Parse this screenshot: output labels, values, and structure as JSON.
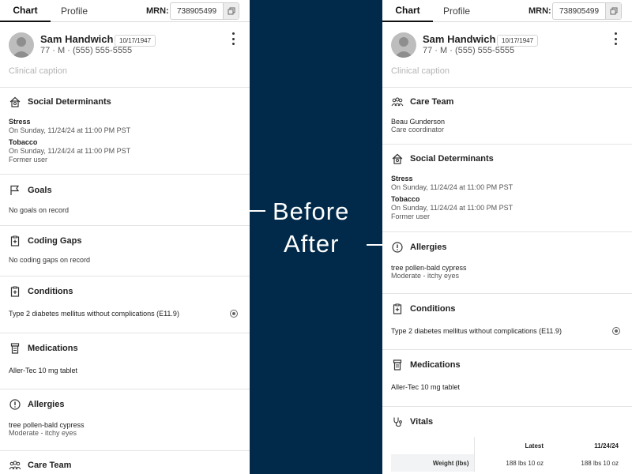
{
  "before": {
    "tabs": {
      "chart": "Chart",
      "profile": "Profile"
    },
    "mrn_label": "MRN:",
    "mrn_value": "738905499",
    "patient": {
      "name": "Sam Handwich",
      "dob": "10/17/1947",
      "demographics": "77 · M · (555) 555-5555",
      "caption_placeholder": "Clinical caption"
    },
    "social": {
      "title": "Social Determinants",
      "items": [
        {
          "title": "Stress",
          "sub": "On Sunday, 11/24/24 at 11:00 PM PST"
        },
        {
          "title": "Tobacco",
          "sub": "On Sunday, 11/24/24 at 11:00 PM PST",
          "sub2": "Former user"
        }
      ]
    },
    "goals": {
      "title": "Goals",
      "empty": "No goals on record"
    },
    "coding": {
      "title": "Coding Gaps",
      "empty": "No coding gaps on record"
    },
    "conditions": {
      "title": "Conditions",
      "item": "Type 2 diabetes mellitus without complications (E11.9)"
    },
    "medications": {
      "title": "Medications",
      "item": "Aller-Tec 10 mg tablet"
    },
    "allergies": {
      "title": "Allergies",
      "item": "tree pollen-bald cypress",
      "sub": "Moderate - itchy eyes"
    },
    "care_team": {
      "title": "Care Team"
    }
  },
  "after": {
    "tabs": {
      "chart": "Chart",
      "profile": "Profile"
    },
    "mrn_label": "MRN:",
    "mrn_value": "738905499",
    "patient": {
      "name": "Sam Handwich",
      "dob": "10/17/1947",
      "demographics": "77 · M · (555) 555-5555",
      "caption_placeholder": "Clinical caption"
    },
    "care_team": {
      "title": "Care Team",
      "member": "Beau Gunderson",
      "role": "Care coordinator"
    },
    "social": {
      "title": "Social Determinants",
      "items": [
        {
          "title": "Stress",
          "sub": "On Sunday, 11/24/24 at 11:00 PM PST"
        },
        {
          "title": "Tobacco",
          "sub": "On Sunday, 11/24/24 at 11:00 PM PST",
          "sub2": "Former user"
        }
      ]
    },
    "allergies": {
      "title": "Allergies",
      "item": "tree pollen-bald cypress",
      "sub": "Moderate - itchy eyes"
    },
    "conditions": {
      "title": "Conditions",
      "item": "Type 2 diabetes mellitus without complications (E11.9)"
    },
    "medications": {
      "title": "Medications",
      "item": "Aller-Tec 10 mg tablet"
    },
    "vitals": {
      "title": "Vitals",
      "columns": [
        "Latest",
        "11/24/24"
      ],
      "rows": [
        {
          "label": "Weight (lbs)",
          "values": [
            "188 lbs 10 oz",
            "188 lbs 10 oz"
          ]
        }
      ]
    }
  },
  "labels": {
    "before": "Before",
    "after": "After"
  },
  "colors": {
    "background": "#012a4a",
    "panel": "#ffffff",
    "caption": "#b5b5b5"
  }
}
